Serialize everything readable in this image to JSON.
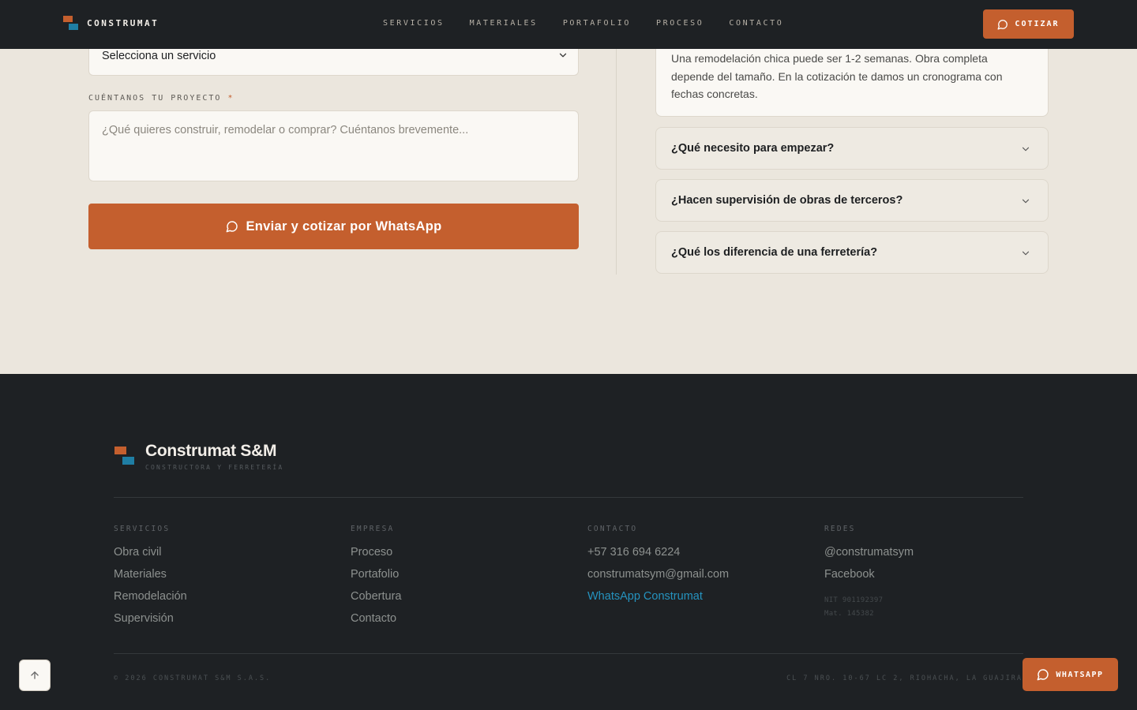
{
  "header": {
    "brand": "CONSTRUMAT",
    "nav": [
      "SERVICIOS",
      "MATERIALES",
      "PORTAFOLIO",
      "PROCESO",
      "CONTACTO"
    ],
    "cta_label": "COTIZAR",
    "accent": "#c45f2e"
  },
  "form": {
    "service_select_value": "Selecciona un servicio",
    "project_label": "CUÉNTANOS TU PROYECTO",
    "required_mark": "*",
    "project_placeholder": "¿Qué quieres construir, remodelar o comprar? Cuéntanos brevemente...",
    "submit_label": "Enviar y cotizar por WhatsApp"
  },
  "faq": {
    "open_answer": "Una remodelación chica puede ser 1-2 semanas. Obra completa depende del tamaño. En la cotización te damos un cronograma con fechas concretas.",
    "questions": [
      "¿Qué necesito para empezar?",
      "¿Hacen supervisión de obras de terceros?",
      "¿Qué los diferencia de una ferretería?"
    ]
  },
  "footer": {
    "brand_name": "Construmat S&M",
    "tagline": "CONSTRUCTORA Y FERRETERÍA",
    "columns": [
      {
        "title": "SERVICIOS",
        "links": [
          "Obra civil",
          "Materiales",
          "Remodelación",
          "Supervisión"
        ]
      },
      {
        "title": "EMPRESA",
        "links": [
          "Proceso",
          "Portafolio",
          "Cobertura",
          "Contacto"
        ]
      },
      {
        "title": "CONTACTO",
        "links": [
          "+57 316 694 6224",
          "construmatsym@gmail.com",
          "WhatsApp Construmat"
        ]
      },
      {
        "title": "REDES",
        "links": [
          "@construmatsym",
          "Facebook"
        ]
      }
    ],
    "nit": "NIT 901192397",
    "mat": "Mat. 145382",
    "copyright": "© 2026 CONSTRUMAT S&M S.A.S.",
    "address": "CL 7 NRO. 10-67 LC 2, RIOHACHA, LA GUAJIRA"
  },
  "floating": {
    "whatsapp_label": "WHATSAPP",
    "whatsapp_link_color": "#2593bf"
  }
}
